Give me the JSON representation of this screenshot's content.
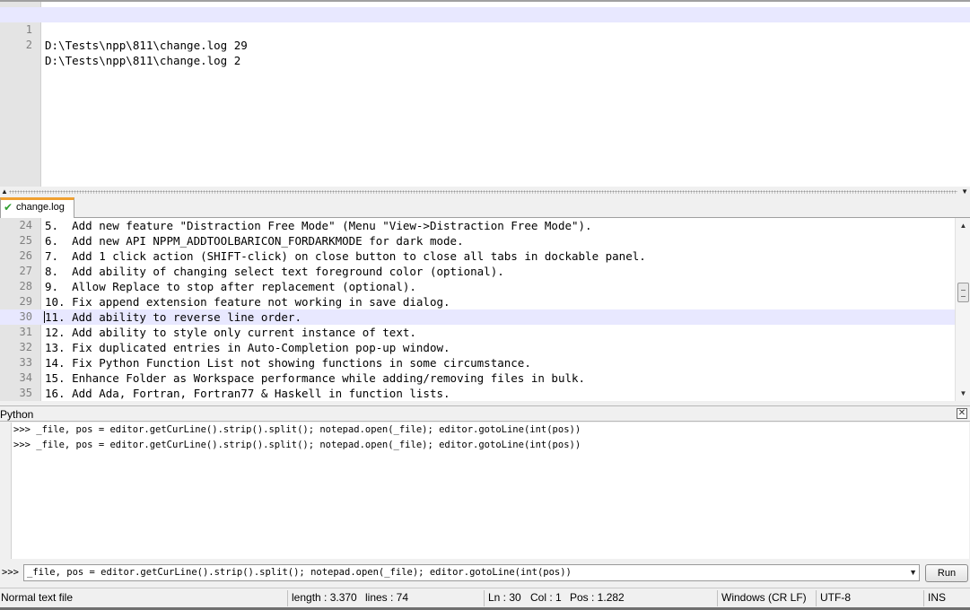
{
  "top_editor": {
    "lines": [
      {
        "num": "1",
        "text": "D:\\Tests\\npp\\811\\change.log 29"
      },
      {
        "num": "2",
        "text": "D:\\Tests\\npp\\811\\change.log 2"
      }
    ]
  },
  "tabs": [
    {
      "label": "change.log"
    }
  ],
  "main_editor": {
    "lines": [
      {
        "num": "24",
        "text": "5.  Add new feature \"Distraction Free Mode\" (Menu \"View->Distraction Free Mode\")."
      },
      {
        "num": "25",
        "text": "6.  Add new API NPPM_ADDTOOLBARICON_FORDARKMODE for dark mode."
      },
      {
        "num": "26",
        "text": "7.  Add 1 click action (SHIFT-click) on close button to close all tabs in dockable panel."
      },
      {
        "num": "27",
        "text": "8.  Add ability of changing select text foreground color (optional)."
      },
      {
        "num": "28",
        "text": "9.  Allow Replace to stop after replacement (optional)."
      },
      {
        "num": "29",
        "text": "10. Fix append extension feature not working in save dialog."
      },
      {
        "num": "30",
        "text": "11. Add ability to reverse line order."
      },
      {
        "num": "31",
        "text": "12. Add ability to style only current instance of text."
      },
      {
        "num": "32",
        "text": "13. Fix duplicated entries in Auto-Completion pop-up window."
      },
      {
        "num": "33",
        "text": "14. Fix Python Function List not showing functions in some circumstance."
      },
      {
        "num": "34",
        "text": "15. Enhance Folder as Workspace performance while adding/removing files in bulk."
      },
      {
        "num": "35",
        "text": "16. Add Ada, Fortran, Fortran77 & Haskell in function lists."
      }
    ]
  },
  "python_console": {
    "title": "Python",
    "output": [
      ">>> _file, pos = editor.getCurLine().strip().split(); notepad.open(_file); editor.gotoLine(int(pos))",
      ">>> _file, pos = editor.getCurLine().strip().split(); notepad.open(_file); editor.gotoLine(int(pos))"
    ],
    "prompt": ">>>",
    "input_value": "_file, pos = editor.getCurLine().strip().split(); notepad.open(_file); editor.gotoLine(int(pos))",
    "run_label": "Run"
  },
  "statusbar": {
    "file_type": "Normal text file",
    "length": "length : 3.370",
    "lines": "lines : 74",
    "ln": "Ln : 30",
    "col": "Col : 1",
    "pos": "Pos : 1.282",
    "eol": "Windows (CR LF)",
    "encoding": "UTF-8",
    "mode": "INS"
  },
  "colors": {
    "current_line": "#e8e8ff",
    "tab_accent": "#f0a030",
    "gutter": "#e4e4e4"
  }
}
